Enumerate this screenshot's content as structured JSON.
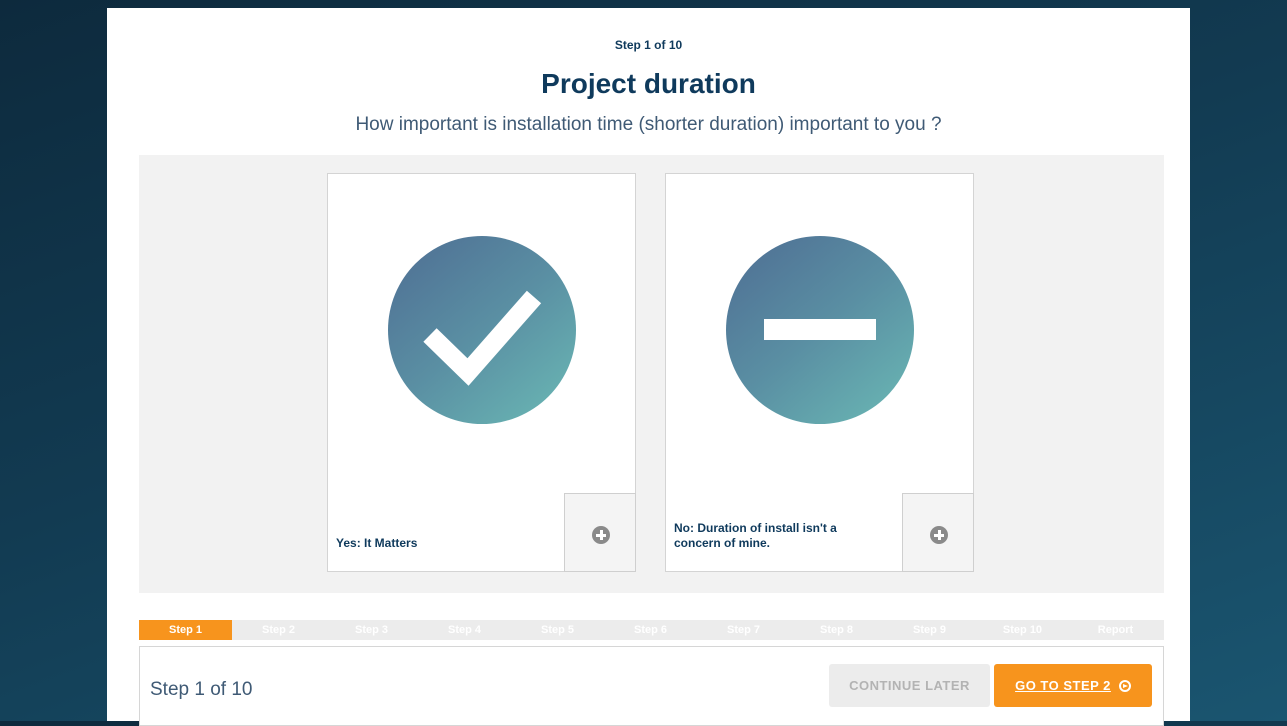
{
  "header": {
    "step_indicator": "Step 1 of 10",
    "title": "Project duration",
    "question": "How important is installation time (shorter duration) important to you ?"
  },
  "options": [
    {
      "label": "Yes: It Matters",
      "icon": "checkmark-icon",
      "expand_icon": "plus-icon"
    },
    {
      "label": "No: Duration of install isn't a concern of mine.",
      "icon": "minus-icon",
      "expand_icon": "plus-icon"
    }
  ],
  "progress": {
    "tabs": [
      "Step 1",
      "Step 2",
      "Step 3",
      "Step 4",
      "Step 5",
      "Step 6",
      "Step 7",
      "Step 8",
      "Step 9",
      "Step 10",
      "Report"
    ],
    "active_index": 0
  },
  "footer": {
    "step_text": "Step 1 of 10",
    "continue_later_label": "CONTINUE LATER",
    "next_label": "GO TO STEP 2",
    "next_icon": "arrow-circle-right-icon"
  },
  "colors": {
    "accent": "#f7941d",
    "heading": "#0f3a5c",
    "circle_start": "#4e6d93",
    "circle_end": "#6bbab5"
  }
}
